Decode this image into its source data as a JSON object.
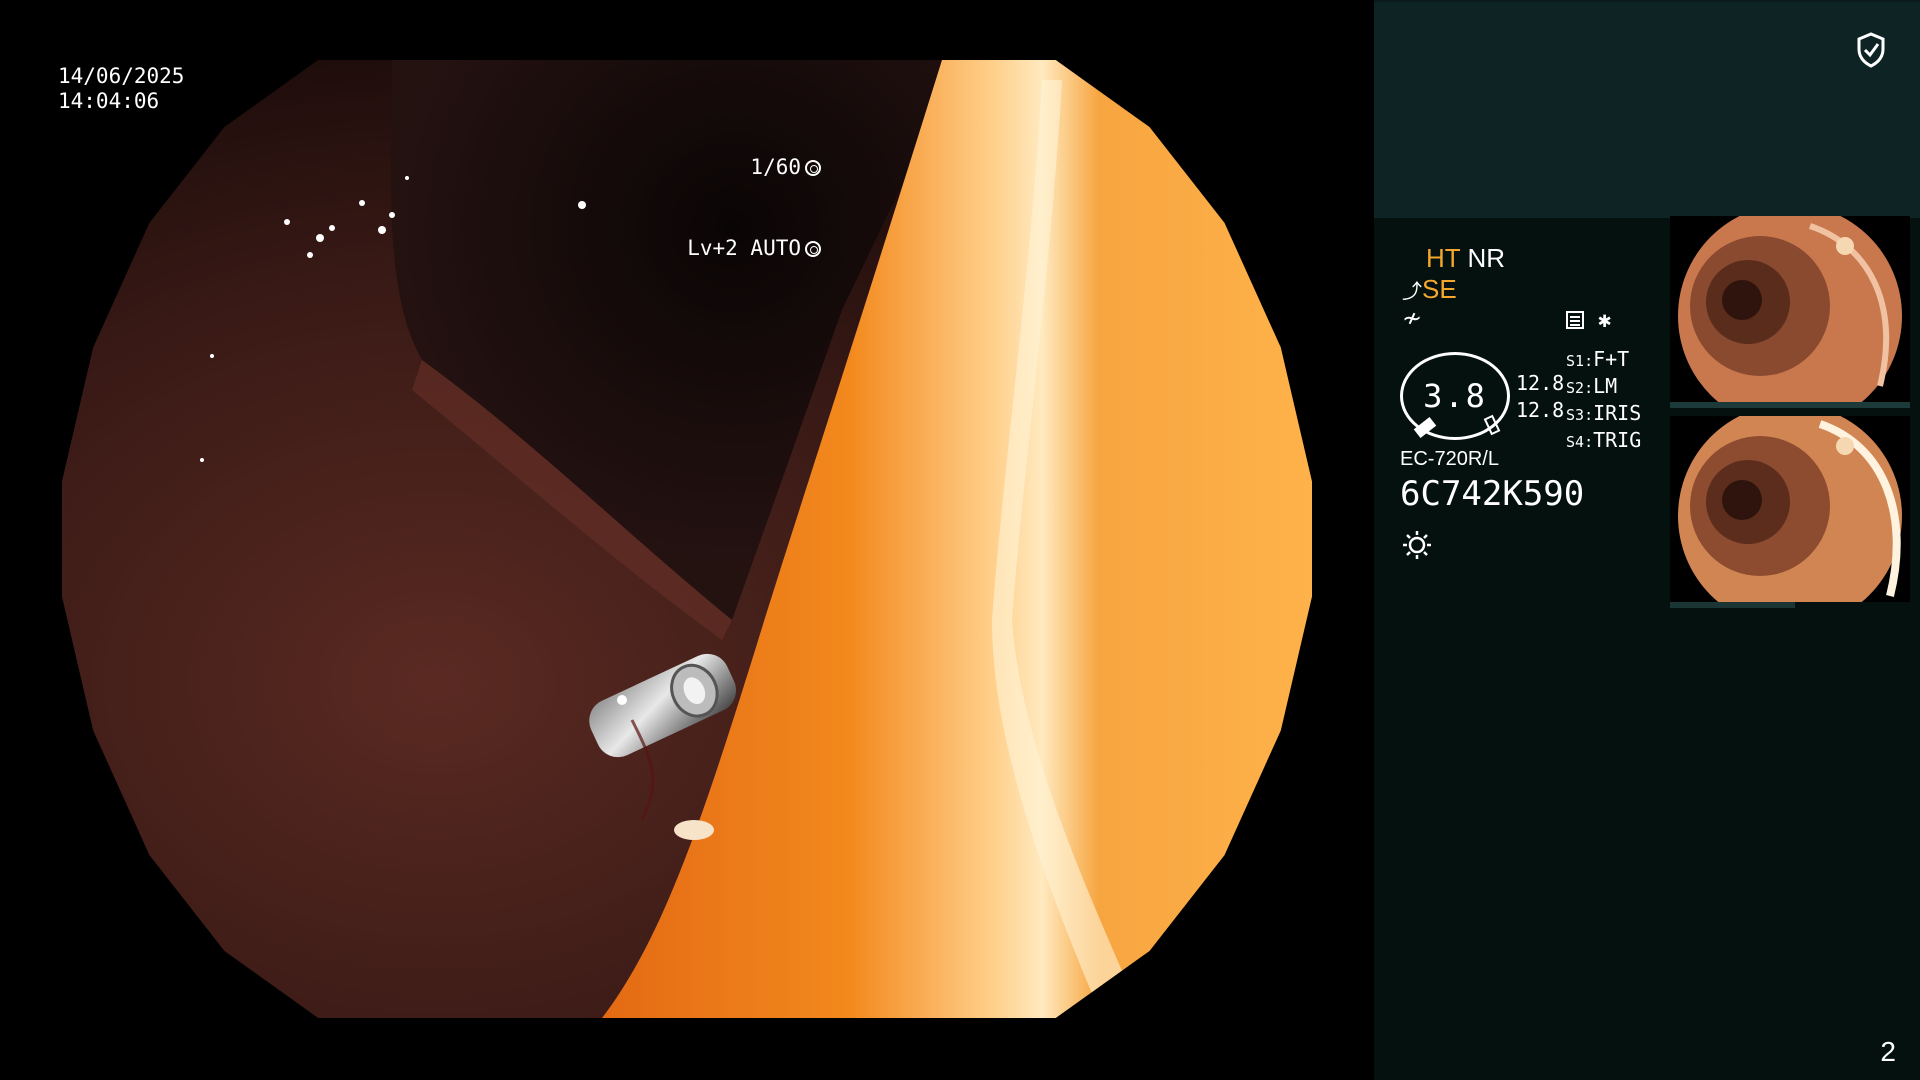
{
  "overlay": {
    "date": "14/06/2025",
    "time": "14:04:06",
    "shutter": "1/60",
    "level": "Lv+2",
    "iris_mode": "AUTO"
  },
  "panel": {
    "ht": "HT",
    "nr": "NR",
    "se": "SE",
    "dial_value": "3.8",
    "values": [
      "12.8",
      "12.8"
    ],
    "switches": [
      {
        "key": "S1",
        "value": "F+T"
      },
      {
        "key": "S2",
        "value": "LM"
      },
      {
        "key": "S3",
        "value": "IRIS"
      },
      {
        "key": "S4",
        "value": "TRIG"
      }
    ],
    "star": "✱",
    "scope_model": "EC-720R/L",
    "serial": "6C742K590",
    "page_number": "2",
    "icons": [
      "shield-check-icon",
      "memo-icon",
      "scope-icon",
      "flex-icon",
      "light-icon"
    ]
  },
  "colors": {
    "panel_bg": "#04110f",
    "panel_top_bg": "#0e2424",
    "accent_orange": "#f4a72c"
  }
}
